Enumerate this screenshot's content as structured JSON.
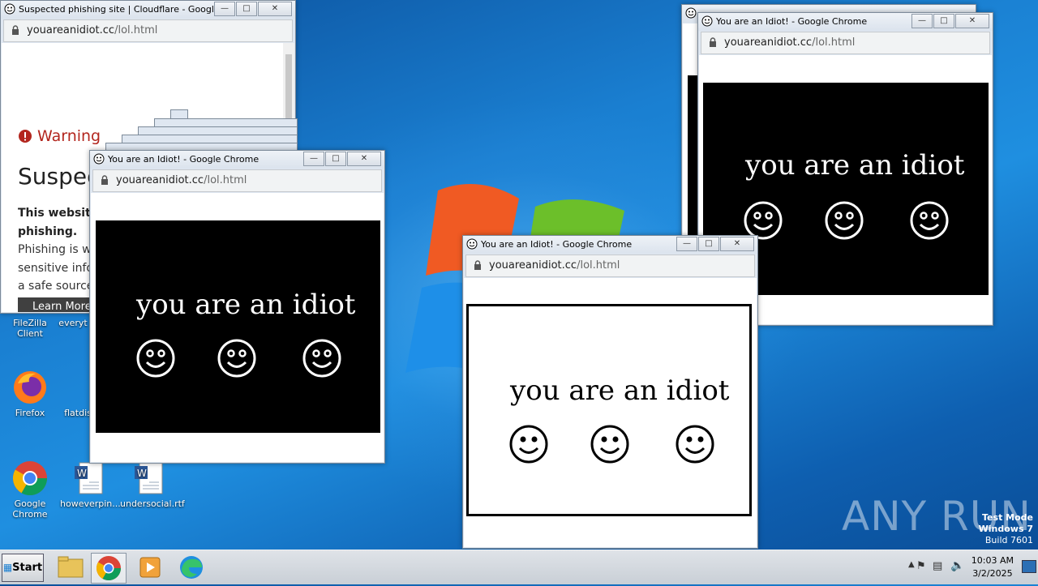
{
  "desktop": {
    "icons": [
      {
        "label": "FileZilla Client"
      },
      {
        "label": "everyt"
      },
      {
        "label": "Firefox"
      },
      {
        "label": "flatdis"
      },
      {
        "label": "Google Chrome"
      },
      {
        "label": "howeverpin..."
      },
      {
        "label": "undersocial.rtf"
      }
    ],
    "watermark": {
      "brand": "ANY RUN",
      "line1": "Test Mode",
      "line2": "Windows 7",
      "line3": "Build 7601"
    }
  },
  "windows": {
    "phishing": {
      "title": "Suspected phishing site | Cloudflare - Google C...",
      "url_domain": "youareanidiot.cc",
      "url_path": "/lol.html",
      "warning": "Warning",
      "heading": "Suspec",
      "bold_line1": "This website",
      "bold_line2": "phishing.",
      "para1": "Phishing is wh",
      "para2": "sensitive infor",
      "para3": "a safe source.",
      "button": "Learn More"
    },
    "idiot_left": {
      "title": "You are an Idiot! - Google Chrome",
      "url_domain": "youareanidiot.cc",
      "url_path": "/lol.html",
      "text": "you are an idiot"
    },
    "idiot_center": {
      "title": "You are an Idiot! - Google Chrome",
      "url_domain": "youareanidiot.cc",
      "url_path": "/lol.html",
      "text": "you are an idiot"
    },
    "idiot_right": {
      "title": "You are an Idiot! - Google Chrome",
      "url_domain": "youareanidiot.cc",
      "url_path": "/lol.html",
      "text": "you are an idiot"
    },
    "stack_title_fragment": "You are an Idiot! - Google Chrome"
  },
  "taskbar": {
    "start_label": "Start",
    "time": "10:03 AM",
    "date": "3/2/2025"
  },
  "colors": {
    "warning_red": "#b3261e",
    "accent_blue": "#1a7fd1"
  }
}
